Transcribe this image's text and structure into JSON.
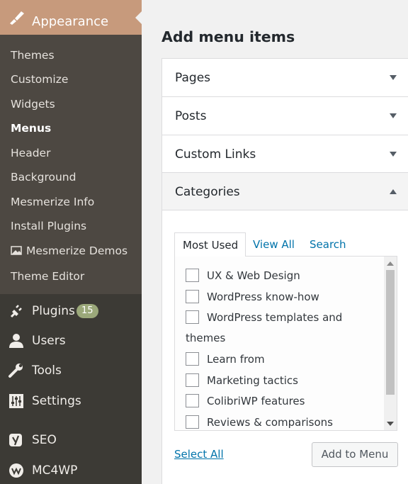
{
  "sidebar": {
    "appearance_label": "Appearance",
    "submenu": [
      {
        "label": "Themes",
        "current": false
      },
      {
        "label": "Customize",
        "current": false
      },
      {
        "label": "Widgets",
        "current": false
      },
      {
        "label": "Menus",
        "current": true
      },
      {
        "label": "Header",
        "current": false
      },
      {
        "label": "Background",
        "current": false
      },
      {
        "label": "Mesmerize Info",
        "current": false
      },
      {
        "label": "Install Plugins",
        "current": false
      },
      {
        "label": "Mesmerize Demos",
        "current": false
      },
      {
        "label": "Theme Editor",
        "current": false
      }
    ],
    "items": [
      {
        "label": "Plugins",
        "icon": "plug-icon",
        "badge": "15"
      },
      {
        "label": "Users",
        "icon": "user-icon"
      },
      {
        "label": "Tools",
        "icon": "wrench-icon"
      },
      {
        "label": "Settings",
        "icon": "settings-sliders-icon"
      },
      {
        "label": "SEO",
        "icon": "yoast-icon"
      },
      {
        "label": "MC4WP",
        "icon": "mc4wp-icon"
      }
    ]
  },
  "main": {
    "title": "Add menu items",
    "sections": [
      {
        "label": "Pages",
        "expanded": false
      },
      {
        "label": "Posts",
        "expanded": false
      },
      {
        "label": "Custom Links",
        "expanded": false
      },
      {
        "label": "Categories",
        "expanded": true
      }
    ],
    "categories": {
      "tabs": [
        "Most Used",
        "View All",
        "Search"
      ],
      "active_tab": "Most Used",
      "items": [
        {
          "label": "UX & Web Design",
          "checked": false
        },
        {
          "label": "WordPress know-how",
          "checked": false
        },
        {
          "label": "WordPress templates and",
          "label_cont": "themes",
          "checked": false
        },
        {
          "label": "Learn from",
          "checked": false
        },
        {
          "label": "Marketing tactics",
          "checked": false
        },
        {
          "label": "ColibriWP features",
          "checked": false
        },
        {
          "label": "Reviews & comparisons",
          "checked": false
        }
      ],
      "select_all": "Select All",
      "add_button": "Add to Menu"
    }
  },
  "colors": {
    "sidebar_bg": "#3c3a35",
    "submenu_bg": "#4d4842",
    "active_bg": "#c79a7c",
    "badge_bg": "#9ba87a",
    "link": "#0073aa"
  }
}
